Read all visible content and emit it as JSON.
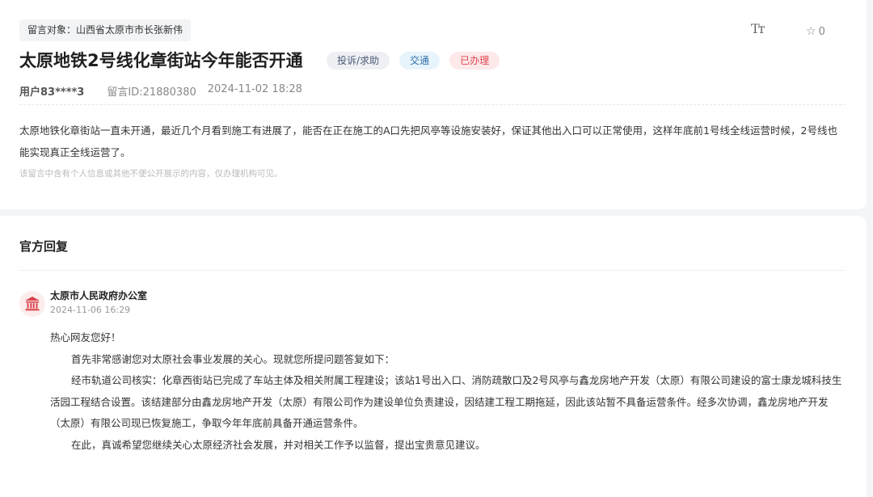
{
  "message": {
    "target": "留言对象：山西省太原市市长张新伟",
    "font_toggle_icon": "font-size-icon",
    "font_toggle": "Tт",
    "favorite_icon": "star-icon",
    "favorite_count": "0",
    "title": "太原地铁2号线化章街站今年能否开通",
    "tags": {
      "type": "投诉/求助",
      "field": "交通",
      "status": "已办理"
    },
    "user": "用户83****3",
    "message_id": "留言ID:21880380",
    "datetime": "2024-11-02 18:28",
    "content": "太原地铁化章街站一直未开通，最近几个月看到施工有进展了，能否在正在施工的A口先把风亭等设施安装好，保证其他出入口可以正常使用，这样年底前1号线全线运营时候，2号线也能实现真正全线运营了。",
    "privacy_note": "该留言中含有个人信息或其他不便公开展示的内容，仅办理机构可见。"
  },
  "reply": {
    "section_title": "官方回复",
    "avatar_icon": "government-building-icon",
    "org": "太原市人民政府办公室",
    "datetime": "2024-11-06 16:29",
    "greeting": "热心网友您好！",
    "paragraphs": [
      "首先非常感谢您对太原社会事业发展的关心。现就您所提问题答复如下：",
      "经市轨道公司核实：化章西街站已完成了车站主体及相关附属工程建设；该站1号出入口、消防疏散口及2号风亭与鑫龙房地产开发（太原）有限公司建设的富士康龙城科技生活园工程结合设置。该结建部分由鑫龙房地产开发（太原）有限公司作为建设单位负责建设，因结建工程工期拖延，因此该站暂不具备运营条件。经多次协调，鑫龙房地产开发（太原）有限公司现已恢复施工，争取今年年底前具备开通运营条件。",
      "在此，真诚希望您继续关心太原经济社会发展，并对相关工作予以监督，提出宝贵意见建议。"
    ]
  },
  "colors": {
    "status_red": "#e0454e",
    "field_blue": "#2e6fa8",
    "avatar_bg": "#fdecec",
    "avatar_icon": "#d9414a"
  }
}
